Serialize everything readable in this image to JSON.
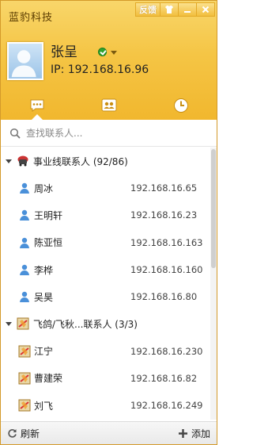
{
  "app": {
    "title": "蓝豹科技"
  },
  "title_controls": {
    "feedback_label": "反馈",
    "skin_icon": "shirt-icon",
    "minimize_icon": "minimize-icon",
    "close_icon": "close-icon"
  },
  "user": {
    "name": "张呈",
    "ip_label": "IP: 192.168.16.96",
    "status": "online"
  },
  "tabs": [
    {
      "icon": "chat-bubble-icon",
      "active": true
    },
    {
      "icon": "contacts-group-icon",
      "active": false
    },
    {
      "icon": "clock-icon",
      "active": false
    }
  ],
  "search": {
    "placeholder": "查找联系人..."
  },
  "groups": [
    {
      "label": "事业线联系人 (92/86)",
      "icon": "group-icon",
      "contacts": [
        {
          "name": "周冰",
          "ip": "192.168.16.65"
        },
        {
          "name": "王明轩",
          "ip": "192.168.16.23"
        },
        {
          "name": "陈亚恒",
          "ip": "192.168.16.163"
        },
        {
          "name": "李桦",
          "ip": "192.168.16.160"
        },
        {
          "name": "吴昊",
          "ip": "192.168.16.80"
        }
      ]
    },
    {
      "label": "飞鸽/飞秋...联系人 (3/3)",
      "icon": "feige-icon",
      "contacts": [
        {
          "name": "江宁",
          "ip": "192.168.16.230"
        },
        {
          "name": "曹建荣",
          "ip": "192.168.16.82"
        },
        {
          "name": "刘飞",
          "ip": "192.168.16.249"
        }
      ]
    }
  ],
  "bottombar": {
    "refresh_label": "刷新",
    "add_label": "添加"
  },
  "colors": {
    "header_top": "#f8d66a",
    "header_bottom": "#f1b72e",
    "online": "#2fa42f",
    "user_icon": "#4a90d9"
  }
}
